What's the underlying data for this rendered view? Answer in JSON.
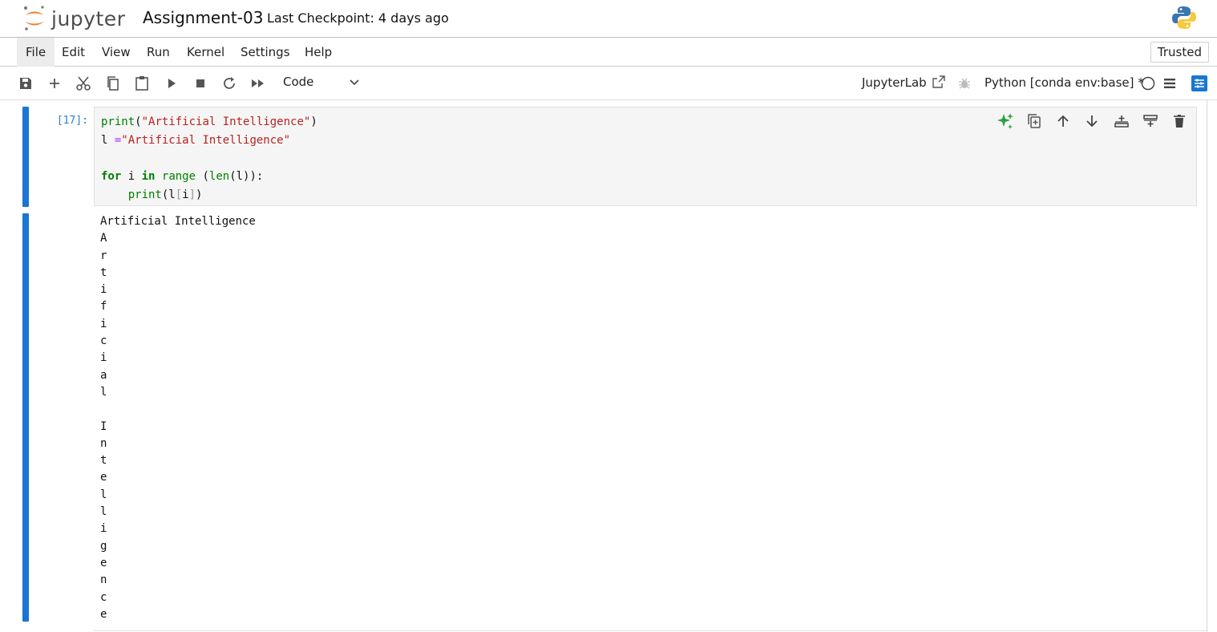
{
  "header": {
    "logo_text": "jupyter",
    "notebook_title": "Assignment-03",
    "checkpoint": "Last Checkpoint: 4 days ago"
  },
  "menu": {
    "items": [
      "File",
      "Edit",
      "View",
      "Run",
      "Kernel",
      "Settings",
      "Help"
    ],
    "active": "File",
    "trusted_label": "Trusted"
  },
  "toolbar": {
    "cell_type": "Code",
    "open_in_label": "JupyterLab",
    "kernel_label": "Python [conda env:base] *",
    "icons": [
      "save-icon",
      "add-cell-icon",
      "cut-icon",
      "copy-icon",
      "paste-icon",
      "run-icon",
      "stop-icon",
      "restart-icon",
      "run-all-icon"
    ]
  },
  "cell": {
    "prompt": "[17]:",
    "code_lines": [
      "print(\"Artificial Intelligence\")",
      "l =\"Artificial Intelligence\"",
      "",
      "for i in range (len(l)):",
      "    print(l[i])"
    ],
    "tools": [
      "ai-assist-icon",
      "duplicate-icon",
      "move-up-icon",
      "move-down-icon",
      "insert-above-icon",
      "insert-below-icon",
      "delete-icon"
    ]
  },
  "output": {
    "lines": [
      "Artificial Intelligence",
      "A",
      "r",
      "t",
      "i",
      "f",
      "i",
      "c",
      "i",
      "a",
      "l",
      " ",
      "I",
      "n",
      "t",
      "e",
      "l",
      "l",
      "i",
      "g",
      "e",
      "n",
      "c",
      "e"
    ]
  },
  "colors": {
    "accent": "#1976d2",
    "keyword": "#008000",
    "string": "#ba2121",
    "operator": "#aa22ff",
    "prompt": "#307fc1",
    "logo_orange": "#f37726"
  }
}
